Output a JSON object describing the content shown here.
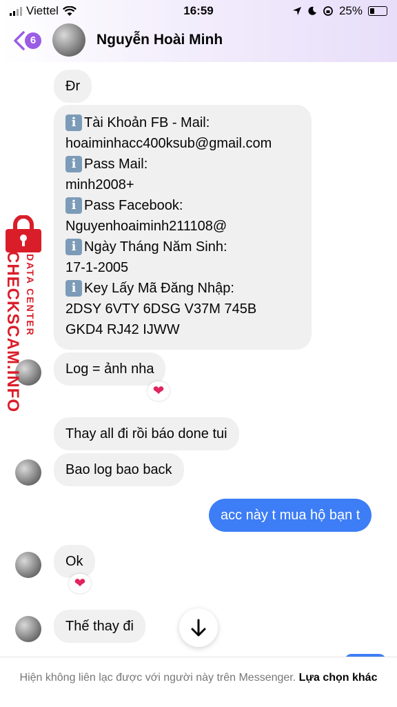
{
  "status_bar": {
    "carrier": "Viettel",
    "time": "16:59",
    "battery": "25%"
  },
  "header": {
    "back_count": "6",
    "contact_name": "Nguyễn Hoài Minh"
  },
  "messages": {
    "m1": "Đr",
    "m2": {
      "l1": "Tài Khoản FB - Mail:",
      "l2": "hoaiminhacc400ksub@gmail.com",
      "l3": "Pass Mail:",
      "l4": "minh2008+",
      "l5": "Pass Facebook:",
      "l6": "Nguyenhoaiminh211108@",
      "l7": "Ngày Tháng Năm Sinh:",
      "l8": "17-1-2005",
      "l9": "Key Lấy Mã Đăng Nhập:",
      "l10": "2DSY 6VTY 6DSG V37M 745B",
      "l11": "GKD4 RJ42 IJWW"
    },
    "m3": "Log = ảnh nha",
    "m4": "Thay all đi rồi báo done tui",
    "m5": "Bao log bao back",
    "m6": "acc này t mua hộ bạn t",
    "m7": "Ok",
    "m8": "Thế thay đi"
  },
  "reactions": {
    "heart": "❤"
  },
  "watermark": {
    "line1": "DATA CENTER",
    "line2": "CHECKSCAM.INFO"
  },
  "footer": {
    "notice": "Hiện không liên lạc được với người này trên Messenger. ",
    "action": "Lựa chọn khác"
  }
}
